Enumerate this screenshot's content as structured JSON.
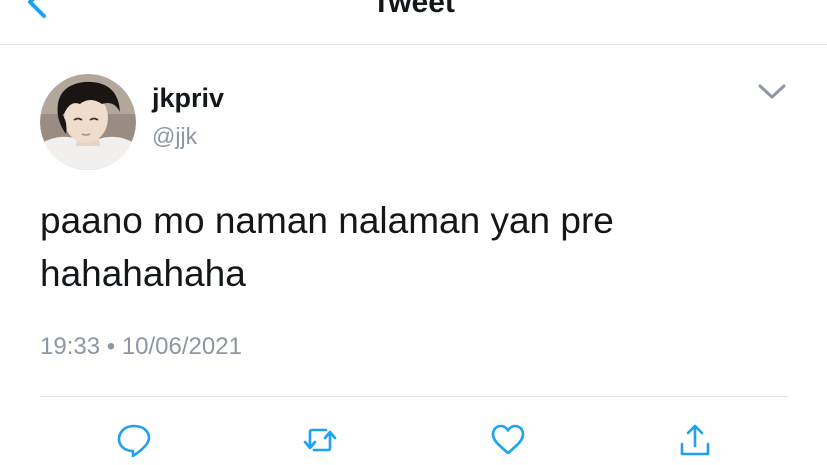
{
  "navbar": {
    "title": "Tweet",
    "back_icon": "chevron-left-icon",
    "accent_color": "#1da1f2"
  },
  "tweet": {
    "display_name": "jkpriv",
    "handle": "@jjk",
    "text_line1": "paano mo naman nalaman yan pre",
    "text_line2": "hahahahaha",
    "time": "19:33",
    "separator": "•",
    "date": "10/06/2021"
  },
  "actions": {
    "reply_icon": "reply-icon",
    "retweet_icon": "retweet-icon",
    "like_icon": "heart-icon",
    "share_icon": "share-icon",
    "icon_color": "#1da1f2"
  },
  "colors": {
    "text_primary": "#14171a",
    "text_secondary": "#8c97a3",
    "divider": "#e1e4e8"
  }
}
